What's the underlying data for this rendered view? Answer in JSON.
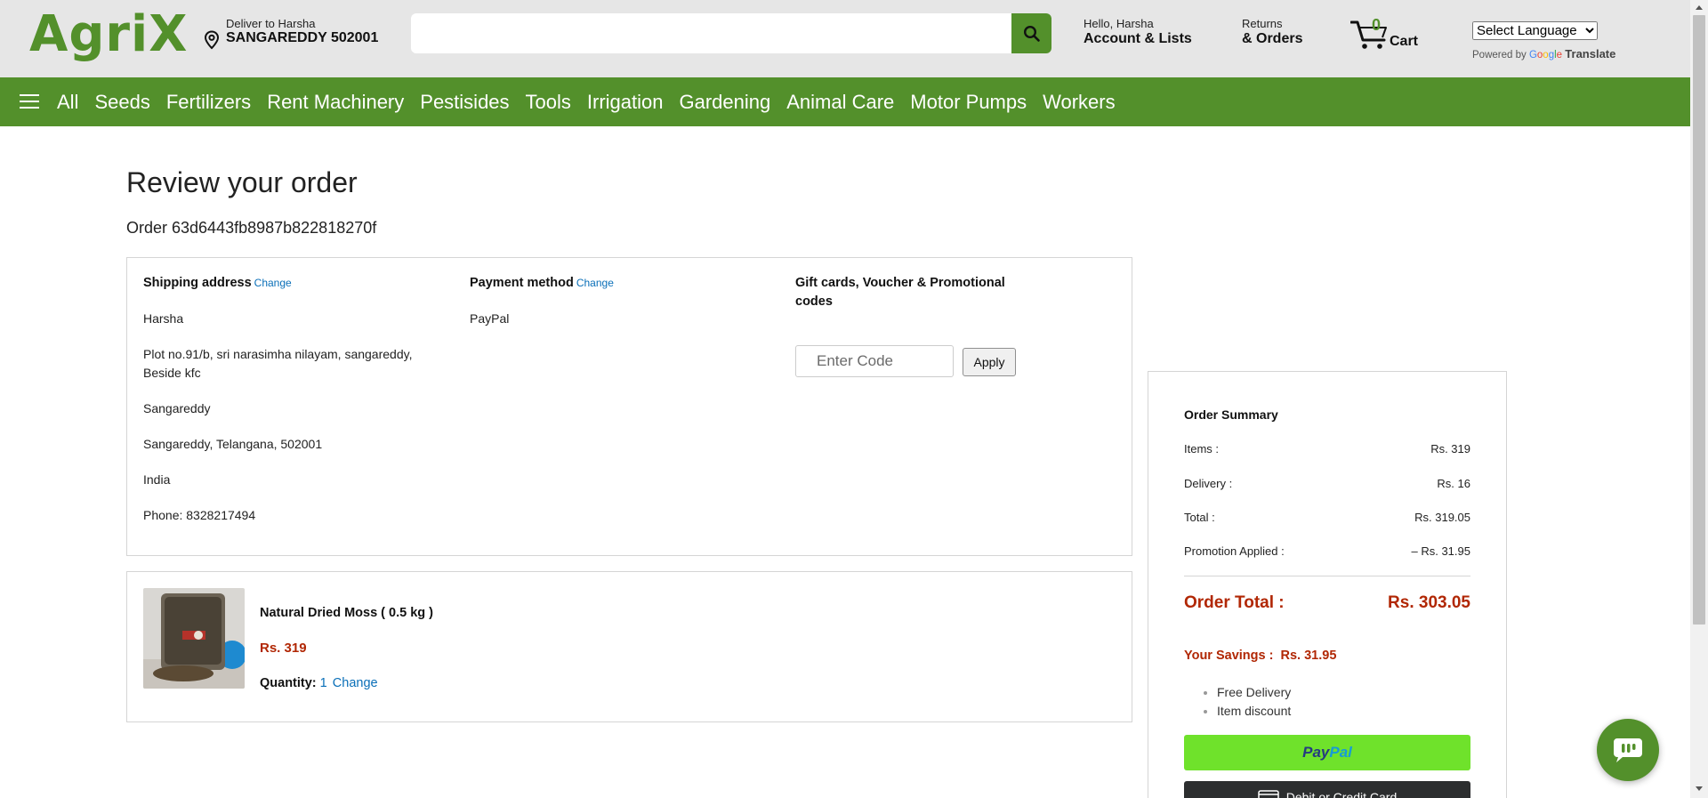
{
  "brand": {
    "logo": "AgriX",
    "primary_color": "#53902b",
    "price_color": "#b12704",
    "link_color": "#0a6fb8"
  },
  "header": {
    "deliver_line1": "Deliver to Harsha",
    "deliver_line2": "SANGAREDDY 502001",
    "search_placeholder": "",
    "account_line1": "Hello, Harsha",
    "account_line2": "Account & Lists",
    "returns_line1": "Returns",
    "returns_line2": "& Orders",
    "cart_count": "0",
    "cart_label": "Cart",
    "language_selected": "Select Language",
    "powered_by": "Powered by",
    "google": "Google",
    "translate": "Translate"
  },
  "nav": {
    "items": [
      "All",
      "Seeds",
      "Fertilizers",
      "Rent Machinery",
      "Pestisides",
      "Tools",
      "Irrigation",
      "Gardening",
      "Animal Care",
      "Motor Pumps",
      "Workers"
    ]
  },
  "page": {
    "title": "Review your order",
    "order_id": "Order 63d6443fb8987b822818270f"
  },
  "shipping": {
    "heading": "Shipping address",
    "change": "Change",
    "name": "Harsha",
    "address": "Plot no.91/b, sri narasimha nilayam, sangareddy, Beside kfc",
    "city": "Sangareddy",
    "region": "Sangareddy, Telangana, 502001",
    "country": "India",
    "phone": "Phone: 8328217494"
  },
  "payment": {
    "heading": "Payment method",
    "change": "Change",
    "method": "PayPal"
  },
  "gift": {
    "heading": "Gift cards, Voucher & Promotional codes",
    "placeholder": "Enter Code",
    "apply": "Apply"
  },
  "item": {
    "name": "Natural Dried Moss ( 0.5 kg )",
    "price": "Rs. 319",
    "quantity_label": "Quantity:",
    "quantity": "1",
    "change": "Change"
  },
  "summary": {
    "title": "Order Summary",
    "rows": [
      {
        "label": "Items :",
        "value": "Rs. 319"
      },
      {
        "label": "Delivery :",
        "value": "Rs. 16"
      },
      {
        "label": "Total :",
        "value": "Rs. 319.05"
      },
      {
        "label": "Promotion Applied :",
        "value": "– Rs. 31.95"
      }
    ],
    "order_total_label": "Order Total :",
    "order_total_value": "Rs. 303.05",
    "savings_label": "Your Savings :",
    "savings_value": "Rs. 31.95",
    "perks": [
      "Free Delivery",
      "Item discount"
    ],
    "paypal_p1": "Pay",
    "paypal_p2": "Pal",
    "card_label": "Debit or Credit Card"
  }
}
